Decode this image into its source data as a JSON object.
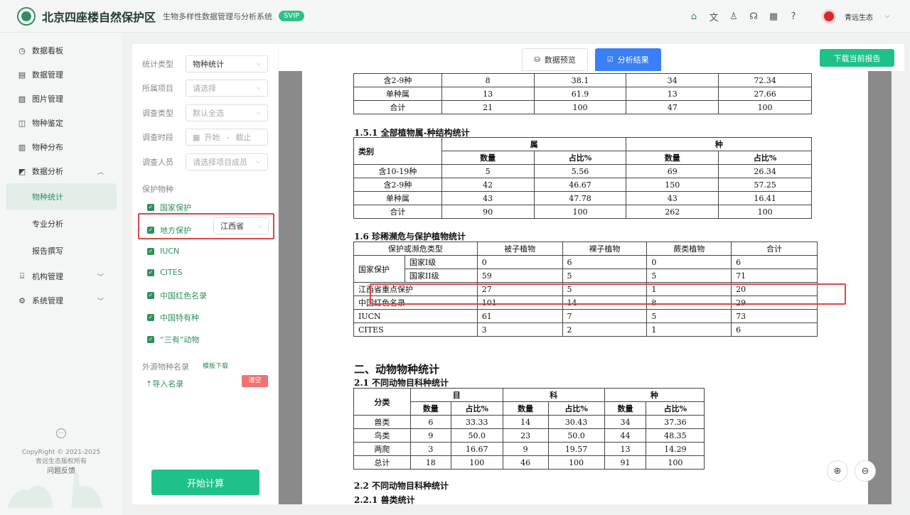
{
  "header": {
    "title": "北京四座楼自然保护区",
    "subtitle": "生物多样性数据管理与分析系统",
    "badge": "SVIP",
    "help": "?",
    "user_name": "青远生态"
  },
  "sidebar": {
    "items": [
      {
        "label": "数据看板",
        "icon": "dashboard-icon"
      },
      {
        "label": "数据管理",
        "icon": "database-icon"
      },
      {
        "label": "图片管理",
        "icon": "image-icon"
      },
      {
        "label": "物种鉴定",
        "icon": "identify-icon"
      },
      {
        "label": "物种分布",
        "icon": "map-icon"
      },
      {
        "label": "数据分析",
        "icon": "chart-icon"
      }
    ],
    "sub_items": [
      "物种统计",
      "专业分析",
      "报告撰写"
    ],
    "items2": [
      {
        "label": "机构管理",
        "icon": "org-icon"
      },
      {
        "label": "系统管理",
        "icon": "settings-icon"
      }
    ],
    "copyright": "CopyRight © 2021-2025",
    "owner": "青远生态版权所有",
    "feedback": "问题反馈"
  },
  "filters": {
    "stat_type": {
      "label": "统计类型",
      "value": "物种统计"
    },
    "project": {
      "label": "所属项目",
      "placeholder": "请选择"
    },
    "survey_type": {
      "label": "调查类型",
      "placeholder": "默认全选"
    },
    "period": {
      "label": "调查时段",
      "start": "开始",
      "sep": "-",
      "end": "截止"
    },
    "staff": {
      "label": "调查人员",
      "placeholder": "请选择项目成员"
    },
    "protect_label": "保护物种",
    "checks": [
      "国家保护",
      "地方保护",
      "IUCN",
      "CITES",
      "中国红色名录",
      "中国特有种",
      "“三有”动物"
    ],
    "region": "江西省",
    "external_label": "外源物种名录",
    "template_link": "模板下载",
    "import_label": "⇡导入名录",
    "clear": "清空",
    "start": "开始计算"
  },
  "main": {
    "tab_preview": "数据预览",
    "tab_result": "分析结果",
    "download": "下载当前报告"
  },
  "report": {
    "top_rows": [
      [
        "含2-9种",
        "8",
        "38.1",
        "34",
        "72.34"
      ],
      [
        "单种属",
        "13",
        "61.9",
        "13",
        "27.66"
      ],
      [
        "合计",
        "21",
        "100",
        "47",
        "100"
      ]
    ],
    "s151_title": "1.5.1 全部植物属-种结构统计",
    "s151_head": [
      "类别",
      "属",
      "种",
      "数量",
      "占比%",
      "数量",
      "占比%"
    ],
    "s151_rows": [
      [
        "含10-19种",
        "5",
        "5.56",
        "69",
        "26.34"
      ],
      [
        "含2-9种",
        "42",
        "46.67",
        "150",
        "57.25"
      ],
      [
        "单种属",
        "43",
        "47.78",
        "43",
        "16.41"
      ],
      [
        "合计",
        "90",
        "100",
        "262",
        "100"
      ]
    ],
    "s16_title": "1.6 珍稀濒危与保护植物统计",
    "s16_head": [
      "保护或濒危类型",
      "被子植物",
      "裸子植物",
      "蕨类植物",
      "合计"
    ],
    "s16_group": "国家保护",
    "s16_rows": [
      [
        "国家I级",
        "0",
        "6",
        "0",
        "6"
      ],
      [
        "国家II级",
        "59",
        "5",
        "5",
        "71"
      ]
    ],
    "s16_rows2": [
      [
        "江西省重点保护",
        "27",
        "5",
        "1",
        "20"
      ],
      [
        "中国红色名录",
        "101",
        "14",
        "8",
        "29"
      ],
      [
        "IUCN",
        "61",
        "7",
        "5",
        "73"
      ],
      [
        "CITES",
        "3",
        "2",
        "1",
        "6"
      ]
    ],
    "s2_title": "二、动物物种统计",
    "s21_title": "2.1 不同动物目科种统计",
    "s21_head": [
      "分类",
      "目",
      "科",
      "种",
      "数量",
      "占比%",
      "数量",
      "占比%",
      "数量",
      "占比%"
    ],
    "s21_rows": [
      [
        "兽类",
        "6",
        "33.33",
        "14",
        "30.43",
        "34",
        "37.36"
      ],
      [
        "鸟类",
        "9",
        "50.0",
        "23",
        "50.0",
        "44",
        "48.35"
      ],
      [
        "两爬",
        "3",
        "16.67",
        "9",
        "19.57",
        "13",
        "14.29"
      ],
      [
        "总计",
        "18",
        "100",
        "46",
        "100",
        "91",
        "100"
      ]
    ],
    "s22_title": "2.2 不同动物目科种统计",
    "s221_title": "2.2.1 兽类统计"
  },
  "colors": {
    "brand": "#2f8f5f",
    "accent": "#1fc18a",
    "tab_active": "#3a7ff5",
    "highlight": "#d94848"
  }
}
